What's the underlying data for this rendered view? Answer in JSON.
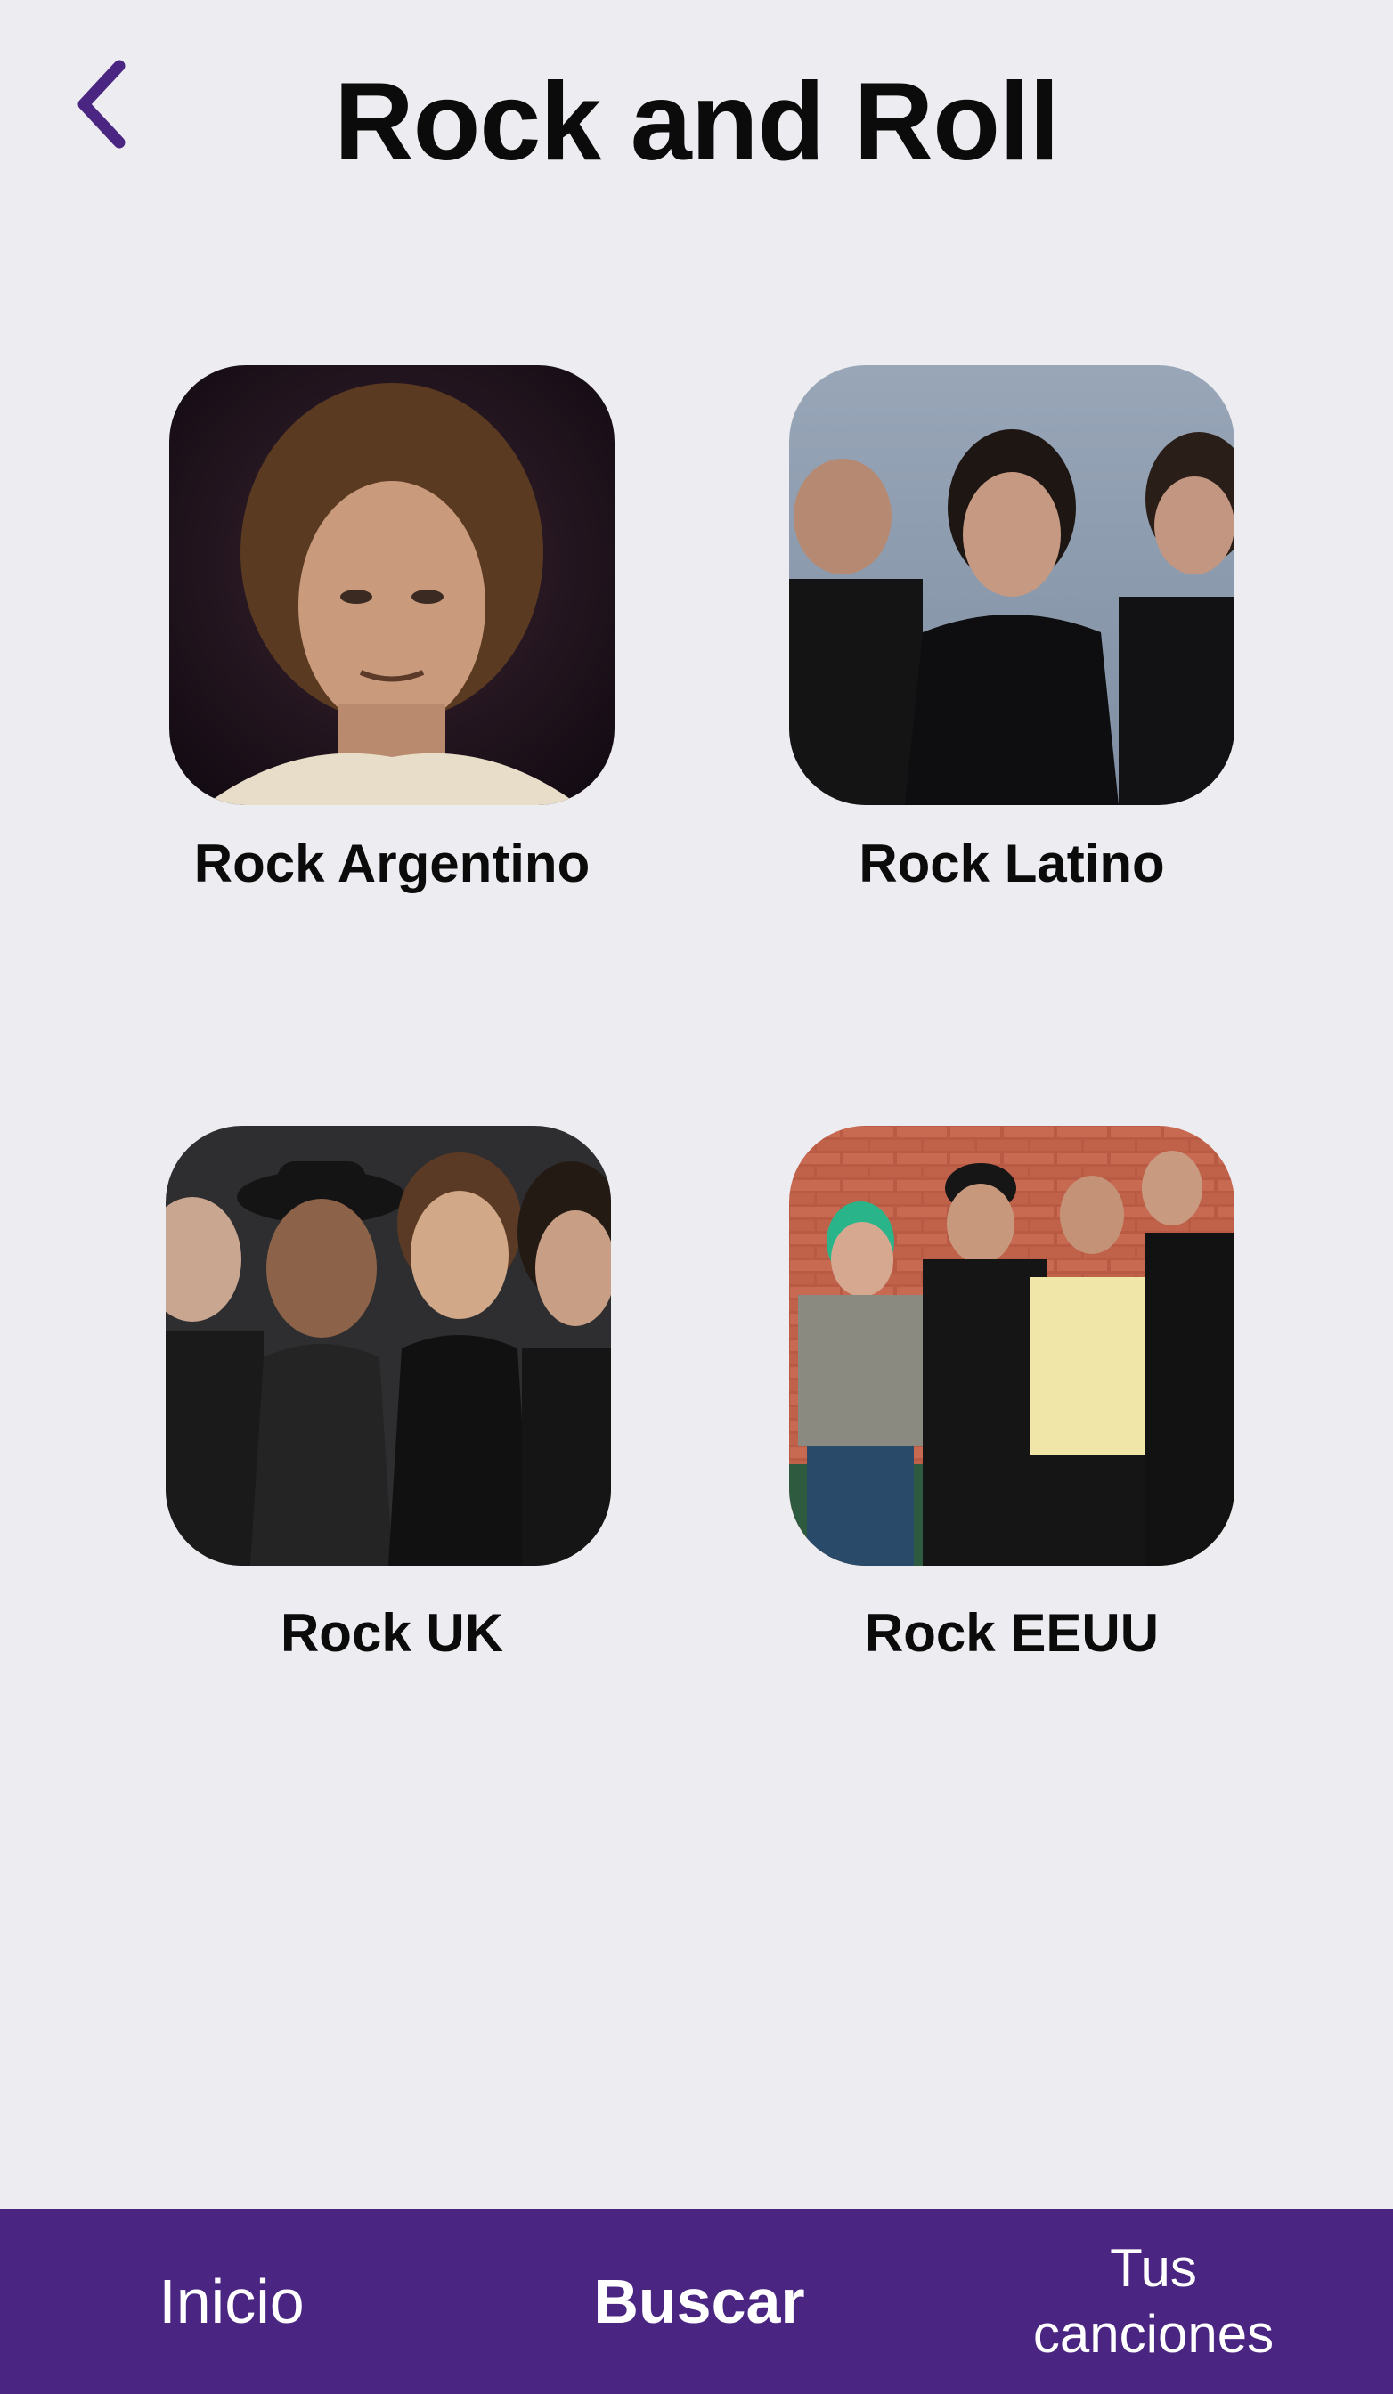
{
  "header": {
    "title": "Rock and Roll",
    "back_icon": "chevron-left-icon"
  },
  "genres": [
    {
      "label": "Rock Argentino"
    },
    {
      "label": "Rock Latino"
    },
    {
      "label": "Rock UK"
    },
    {
      "label": "Rock EEUU"
    }
  ],
  "bottom_nav": {
    "items": [
      {
        "label": "Inicio",
        "active": false
      },
      {
        "label": "Buscar",
        "active": true
      },
      {
        "label": "Tus canciones",
        "active": false
      }
    ]
  },
  "colors": {
    "accent": "#4a2682",
    "background": "#edecf0",
    "text": "#0b0b0b"
  }
}
